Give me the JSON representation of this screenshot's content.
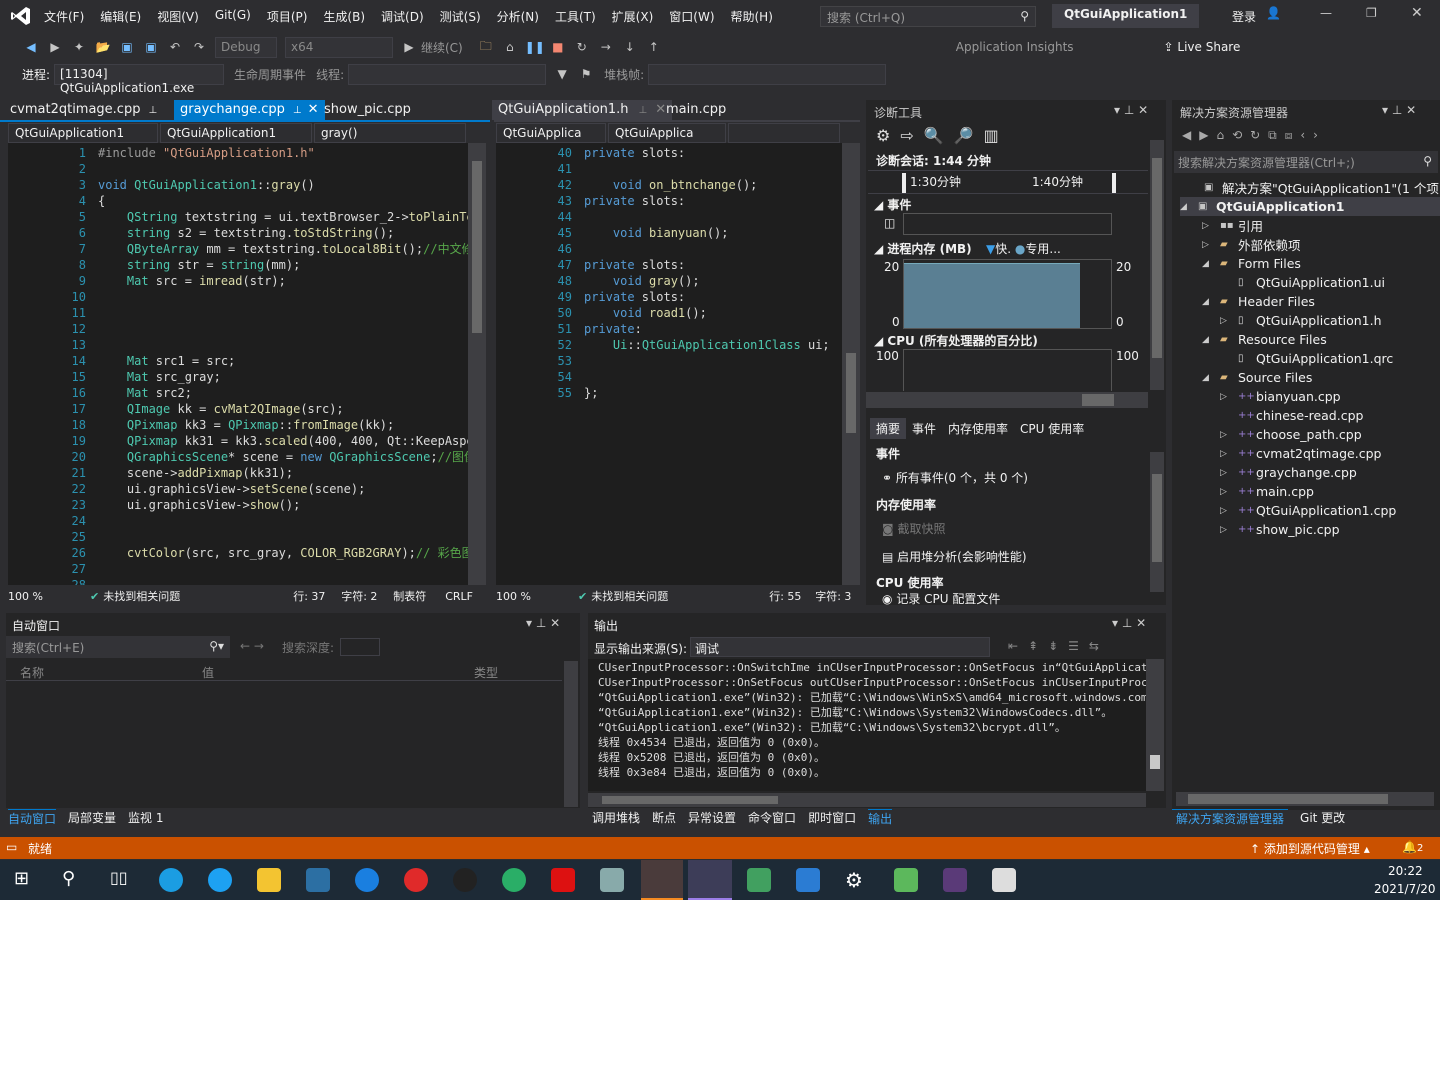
{
  "menu": [
    "文件(F)",
    "编辑(E)",
    "视图(V)",
    "Git(G)",
    "项目(P)",
    "生成(B)",
    "调试(D)",
    "测试(S)",
    "分析(N)",
    "工具(T)",
    "扩展(X)",
    "窗口(W)",
    "帮助(H)"
  ],
  "search_placeholder": "搜索 (Ctrl+Q)",
  "app_title": "QtGuiApplication1",
  "login": "登录",
  "toolbar": {
    "config": "Debug",
    "platform": "x64",
    "continue": "继续(C)",
    "insights": "Application Insights",
    "live_share": "Live Share"
  },
  "debugbar": {
    "process_label": "进程:",
    "process": "[11304] QtGuiApplication1.exe",
    "lifecycle": "生命周期事件",
    "thread_label": "线程:",
    "stack_label": "堆栈帧:"
  },
  "left_editor": {
    "tabs": [
      "cvmat2qtimage.cpp",
      "graychange.cpp",
      "show_pic.cpp"
    ],
    "nav": [
      "QtGuiApplication1",
      "QtGuiApplication1",
      "gray()"
    ],
    "lines": [
      [
        [
          "pp",
          "#include "
        ],
        [
          "st",
          "\"QtGuiApplication1.h\""
        ]
      ],
      [],
      [
        [
          "kw",
          "void "
        ],
        [
          "ty",
          "QtGuiApplication1"
        ],
        [
          "tx",
          "::"
        ],
        [
          "fn",
          "gray"
        ],
        [
          "tx",
          "()"
        ]
      ],
      [
        [
          "tx",
          "{"
        ]
      ],
      [
        [
          "ty",
          "    QString "
        ],
        [
          "tx",
          "textstring = ui.textBrowser_2->"
        ],
        [
          "fn",
          "toPlainTex"
        ]
      ],
      [
        [
          "ty",
          "    string "
        ],
        [
          "tx",
          "s2 = textstring."
        ],
        [
          "fn",
          "toStdString"
        ],
        [
          "tx",
          "();"
        ]
      ],
      [
        [
          "ty",
          "    QByteArray "
        ],
        [
          "tx",
          "mm = textstring."
        ],
        [
          "fn",
          "toLocal8Bit"
        ],
        [
          "tx",
          "();"
        ],
        [
          "cm",
          "//中文修"
        ]
      ],
      [
        [
          "ty",
          "    string "
        ],
        [
          "tx",
          "str = "
        ],
        [
          "ty",
          "string"
        ],
        [
          "tx",
          "(mm);"
        ]
      ],
      [
        [
          "ty",
          "    Mat "
        ],
        [
          "tx",
          "src = "
        ],
        [
          "fn",
          "imread"
        ],
        [
          "tx",
          "(str);"
        ]
      ],
      [],
      [],
      [],
      [],
      [
        [
          "ty",
          "    Mat "
        ],
        [
          "tx",
          "src1 = src;"
        ]
      ],
      [
        [
          "ty",
          "    Mat "
        ],
        [
          "tx",
          "src_gray;"
        ]
      ],
      [
        [
          "ty",
          "    Mat "
        ],
        [
          "tx",
          "src2;"
        ]
      ],
      [
        [
          "ty",
          "    QImage "
        ],
        [
          "tx",
          "kk = "
        ],
        [
          "fn",
          "cvMat2QImage"
        ],
        [
          "tx",
          "(src);"
        ]
      ],
      [
        [
          "ty",
          "    QPixmap "
        ],
        [
          "tx",
          "kk3 = "
        ],
        [
          "ty",
          "QPixmap"
        ],
        [
          "tx",
          "::"
        ],
        [
          "fn",
          "fromImage"
        ],
        [
          "tx",
          "(kk);"
        ]
      ],
      [
        [
          "ty",
          "    QPixmap "
        ],
        [
          "tx",
          "kk31 = kk3."
        ],
        [
          "fn",
          "scaled"
        ],
        [
          "tx",
          "(400, 400, Qt::KeepAspec"
        ]
      ],
      [
        [
          "ty",
          "    QGraphicsScene"
        ],
        [
          "tx",
          "* scene = "
        ],
        [
          "kw",
          "new "
        ],
        [
          "ty",
          "QGraphicsScene"
        ],
        [
          "tx",
          ";"
        ],
        [
          "cm",
          "//图像"
        ]
      ],
      [
        [
          "tx",
          "    scene->"
        ],
        [
          "fn",
          "addPixmap"
        ],
        [
          "tx",
          "(kk31);"
        ]
      ],
      [
        [
          "tx",
          "    ui.graphicsView->"
        ],
        [
          "fn",
          "setScene"
        ],
        [
          "tx",
          "(scene);"
        ]
      ],
      [
        [
          "tx",
          "    ui.graphicsView->"
        ],
        [
          "fn",
          "show"
        ],
        [
          "tx",
          "();"
        ]
      ],
      [],
      [],
      [
        [
          "fn",
          "    cvtColor"
        ],
        [
          "tx",
          "(src, src_gray, "
        ],
        [
          "fn",
          "COLOR_RGB2GRAY"
        ],
        [
          "tx",
          ");"
        ],
        [
          "cm",
          "// 彩色图"
        ]
      ],
      [],
      []
    ],
    "first_line": 1,
    "zoom": "100 %",
    "issues": "未找到相关问题",
    "row": "行: 37",
    "col": "字符: 2",
    "tabs_mode": "制表符",
    "eol": "CRLF"
  },
  "right_editor": {
    "tabs": [
      "QtGuiApplication1.h",
      "main.cpp"
    ],
    "nav": [
      "QtGuiApplica",
      "QtGuiApplica"
    ],
    "lines": [
      [
        [
          "kw",
          "private "
        ],
        [
          "tx",
          "slots:"
        ]
      ],
      [],
      [
        [
          "kw",
          "    void "
        ],
        [
          "fn",
          "on_btnchange"
        ],
        [
          "tx",
          "();"
        ]
      ],
      [
        [
          "kw",
          "private "
        ],
        [
          "tx",
          "slots:"
        ]
      ],
      [],
      [
        [
          "kw",
          "    void "
        ],
        [
          "fn",
          "bianyuan"
        ],
        [
          "tx",
          "();"
        ]
      ],
      [],
      [
        [
          "kw",
          "private "
        ],
        [
          "tx",
          "slots:"
        ]
      ],
      [
        [
          "kw",
          "    void "
        ],
        [
          "fn",
          "gray"
        ],
        [
          "tx",
          "();"
        ]
      ],
      [
        [
          "kw",
          "private "
        ],
        [
          "tx",
          "slots:"
        ]
      ],
      [
        [
          "kw",
          "    void "
        ],
        [
          "fn",
          "road1"
        ],
        [
          "tx",
          "();"
        ]
      ],
      [
        [
          "kw",
          "private"
        ],
        [
          "tx",
          ":"
        ]
      ],
      [
        [
          "ty",
          "    Ui"
        ],
        [
          "tx",
          "::"
        ],
        [
          "ty",
          "QtGuiApplication1Class "
        ],
        [
          "tx",
          "ui;"
        ]
      ],
      [],
      [],
      [
        [
          "tx",
          "};"
        ]
      ]
    ],
    "first_line": 40,
    "zoom": "100 %",
    "issues": "未找到相关问题",
    "row": "行: 55",
    "col": "字符: 3"
  },
  "diag": {
    "title": "诊断工具",
    "session": "诊断会话: 1:44 分钟",
    "t1": "1:30分钟",
    "t2": "1:40分钟",
    "events": "事件",
    "memory": "进程内存 (MB)",
    "legend_snap": "快.",
    "legend_private": "专用...",
    "mem_max": "20",
    "mem_min": "0",
    "cpu": "CPU (所有处理器的百分比)",
    "cpu_max": "100",
    "memory_level_mb": 19,
    "tabs": [
      "摘要",
      "事件",
      "内存使用率",
      "CPU 使用率"
    ],
    "sec_events": "事件",
    "all_events": "所有事件(0 个，共 0 个)",
    "sec_mem": "内存使用率",
    "snapshot": "截取快照",
    "heap": "启用堆分析(会影响性能)",
    "sec_cpu": "CPU 使用率",
    "cpu_profile": "记录 CPU 配置文件"
  },
  "solution": {
    "title": "解决方案资源管理器",
    "search": "搜索解决方案资源管理器(Ctrl+;)",
    "items": [
      {
        "label": "解决方案\"QtGuiApplication1\"(1 个项目/共",
        "level": 0,
        "icon": "solution"
      },
      {
        "label": "QtGuiApplication1",
        "level": 0,
        "icon": "project",
        "bold": true,
        "arrow": "◢"
      },
      {
        "label": "引用",
        "level": 1,
        "icon": "references",
        "arrow": "▷"
      },
      {
        "label": "外部依赖项",
        "level": 1,
        "icon": "folder",
        "arrow": "▷"
      },
      {
        "label": "Form Files",
        "level": 1,
        "icon": "folder",
        "arrow": "◢"
      },
      {
        "label": "QtGuiApplication1.ui",
        "level": 2,
        "icon": "file"
      },
      {
        "label": "Header Files",
        "level": 1,
        "icon": "folder",
        "arrow": "◢"
      },
      {
        "label": "QtGuiApplication1.h",
        "level": 2,
        "icon": "file",
        "arrow": "▷"
      },
      {
        "label": "Resource Files",
        "level": 1,
        "icon": "folder",
        "arrow": "◢"
      },
      {
        "label": "QtGuiApplication1.qrc",
        "level": 2,
        "icon": "file"
      },
      {
        "label": "Source Files",
        "level": 1,
        "icon": "folder",
        "arrow": "◢"
      },
      {
        "label": "bianyuan.cpp",
        "level": 2,
        "icon": "cpp",
        "arrow": "▷"
      },
      {
        "label": "chinese-read.cpp",
        "level": 2,
        "icon": "cpp"
      },
      {
        "label": "choose_path.cpp",
        "level": 2,
        "icon": "cpp",
        "arrow": "▷"
      },
      {
        "label": "cvmat2qtimage.cpp",
        "level": 2,
        "icon": "cpp",
        "arrow": "▷"
      },
      {
        "label": "graychange.cpp",
        "level": 2,
        "icon": "cpp",
        "arrow": "▷"
      },
      {
        "label": "main.cpp",
        "level": 2,
        "icon": "cpp",
        "arrow": "▷"
      },
      {
        "label": "QtGuiApplication1.cpp",
        "level": 2,
        "icon": "cpp",
        "arrow": "▷"
      },
      {
        "label": "show_pic.cpp",
        "level": 2,
        "icon": "cpp",
        "arrow": "▷"
      }
    ],
    "bottom_tabs": [
      "解决方案资源管理器",
      "Git 更改"
    ]
  },
  "auto": {
    "title": "自动窗口",
    "search": "搜索(Ctrl+E)",
    "depth": "搜索深度:",
    "cols": [
      "名称",
      "值",
      "类型"
    ],
    "tabs": [
      "自动窗口",
      "局部变量",
      "监视 1"
    ]
  },
  "output": {
    "title": "输出",
    "source_label": "显示输出来源(S):",
    "source": "调试",
    "lines": [
      "CUserInputProcessor::OnSwitchIme inCUserInputProcessor::OnSetFocus in“QtGuiApplication1.ex",
      "CUserInputProcessor::OnSetFocus outCUserInputProcessor::OnSetFocus inCUserInputProcessor::O",
      "“QtGuiApplication1.exe”(Win32): 已加载“C:\\Windows\\WinSxS\\amd64_microsoft.windows.common-",
      "“QtGuiApplication1.exe”(Win32): 已加载“C:\\Windows\\System32\\WindowsCodecs.dll”。",
      "“QtGuiApplication1.exe”(Win32): 已加载“C:\\Windows\\System32\\bcrypt.dll”。",
      "线程 0x4534 已退出，返回值为 0 (0x0)。",
      "线程 0x5208 已退出，返回值为 0 (0x0)。",
      "线程 0x3e84 已退出，返回值为 0 (0x0)。"
    ],
    "tabs": [
      "调用堆栈",
      "断点",
      "异常设置",
      "命令窗口",
      "即时窗口",
      "输出"
    ]
  },
  "statusbar": {
    "ready": "就绪",
    "source_control": "添加到源代码管理",
    "notifications": "2"
  },
  "taskbar": {
    "time": "20:22",
    "date": "2021/7/20"
  },
  "colors": {
    "accent": "#007acc",
    "status": "#ca5100",
    "bg": "#2d2d30",
    "editor": "#1e1e1e"
  }
}
